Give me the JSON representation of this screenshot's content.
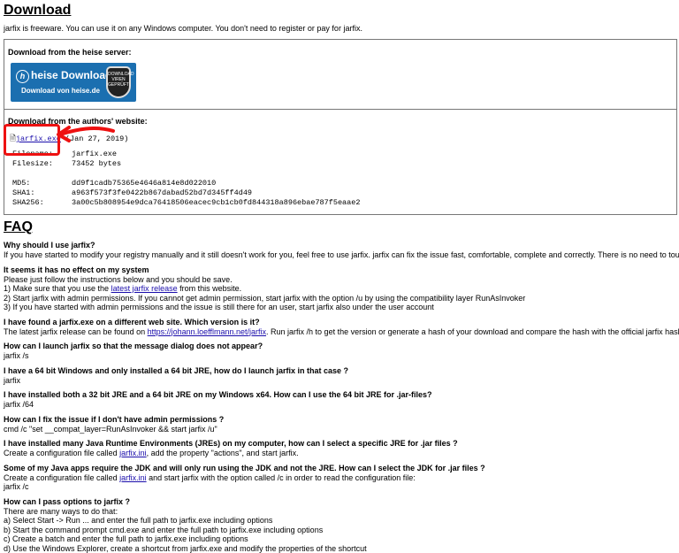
{
  "download": {
    "title": "Download",
    "intro": "jarfix is freeware. You can use it on any Windows computer. You don't need to register or pay for jarfix.",
    "heise_label": "Download from the heise server:",
    "heise_badge": {
      "title": "heise Download",
      "sub": "Download von heise.de",
      "shield": "DOWNLOAD VIREN GEPRÜFT"
    },
    "authors_label": "Download from the authors' website:",
    "link_text": "jarfix.exe",
    "link_date": " (Jan 27, 2019)",
    "file": [
      {
        "k": "Filename:",
        "v": "jarfix.exe"
      },
      {
        "k": "Filesize:",
        "v": "73452 bytes"
      }
    ],
    "hashes": [
      {
        "k": "MD5:",
        "v": "dd9f1cadb75365e4646a814e8d022010"
      },
      {
        "k": "SHA1:",
        "v": "a963f573f3fe0422b867dabad52bd7d345ff4d49"
      },
      {
        "k": "SHA256:",
        "v": "3a00c5b808954e9dca76418506eacec9cb1cb0fd844318a896ebae787f5eaae2"
      }
    ]
  },
  "faq": {
    "title": "FAQ",
    "q1": "Why should I use jarfix?",
    "a1": "If you have started to modify your registry manually and it still doesn't work for you, feel free to use jarfix. jarfix can fix the issue fast, comfortable, complete and correctly. There is no need to touch the re",
    "q2": "It seems it has no effect on my system",
    "a2_1": "Please just follow the instructions below and you should be save.",
    "a2_2a": "1) Make sure that you use the ",
    "a2_2link": "latest jarfix release",
    "a2_2b": " from this website.",
    "a2_3": "2) Start jarfix with admin permissions. If you cannot get admin permission, start jarfix with the option /u by using the compatibility layer RunAsInvoker",
    "a2_4": "3) If you have started with admin permissions and the issue is still there for an user, start jarfix also under the user account",
    "q3": "I have found a jarfix.exe on a different web site. Which version is it?",
    "a3a": "The latest jarfix release can be found on ",
    "a3link": "https://johann.loefflmann.net/jarfix",
    "a3b": ". Run jarfix /h to get the version or generate a hash of your download and compare the hash with the official jarfix hashes at ",
    "a3link2": "ht",
    "q4": "How can I launch jarfix so that the message dialog does not appear?",
    "a4": "jarfix /s",
    "q5": "I have a 64 bit Windows and only installed a 64 bit JRE, how do I launch jarfix in that case ?",
    "a5": "jarfix",
    "q6": "I have installed both a 32 bit JRE and a 64 bit JRE on my Windows x64. How can I use the 64 bit JRE for .jar-files?",
    "a6": "jarfix /64",
    "q7": "How can I fix the issue if I don't have admin permissions ?",
    "a7": "cmd /c \"set __compat_layer=RunAsInvoker && start jarfix /u\"",
    "q8": "I have installed many Java Runtime Environments (JREs) on my computer, how can I select a specific JRE for .jar files ?",
    "a8a": "Create a configuration file called ",
    "a8link": "jarfix.ini",
    "a8b": ", add the property \"actions\", and start jarfix.",
    "q9": "Some of my Java apps require the JDK and will only run using the JDK and not the JRE. How can I select the JDK for .jar files ?",
    "a9a": "Create a configuration file called ",
    "a9link": "jarfix.ini",
    "a9b": " and start jarfix with the option called /c in order to read the configuration file:",
    "a9c": "jarfix /c",
    "q10": "How can I pass options to jarfix  ?",
    "a10_0": "There are many ways to do that:",
    "a10_1": "a) Select Start -> Run ... and enter the full path to jarfix.exe including options",
    "a10_2": "b) Start the command prompt cmd.exe and enter the full path to jarfix.exe including options",
    "a10_3": "c) Create a batch and enter the full path to jarfix.exe including options",
    "a10_4": "d) Use the Windows Explorer, create a shortcut from jarfix.exe and modify the properties of the shortcut"
  },
  "colors": {
    "link": "#1a0dab",
    "annotation": "#e11111",
    "badge": "#1b6fb0"
  }
}
